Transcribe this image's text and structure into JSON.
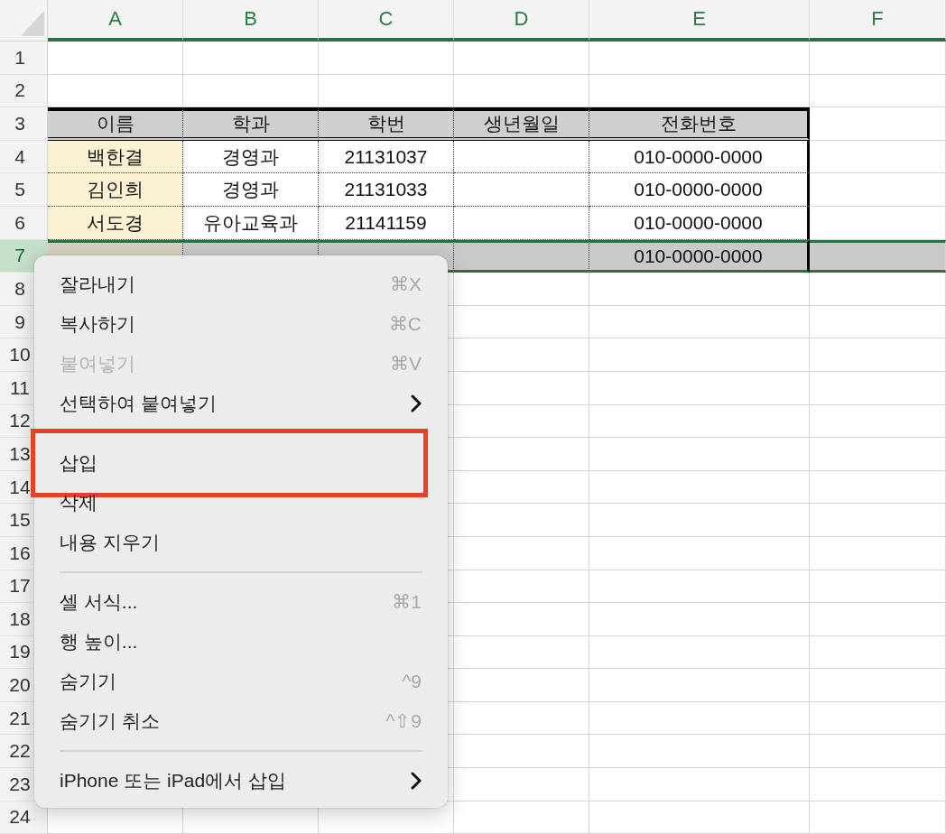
{
  "columns": [
    "A",
    "B",
    "C",
    "D",
    "E",
    "F"
  ],
  "rows": [
    {
      "number": "1",
      "selected": false,
      "kind": "empty"
    },
    {
      "number": "2",
      "selected": false,
      "kind": "empty"
    },
    {
      "number": "3",
      "selected": false,
      "kind": "header",
      "cells": {
        "A": "이름",
        "B": "학과",
        "C": "학번",
        "D": "생년월일",
        "E": "전화번호"
      }
    },
    {
      "number": "4",
      "selected": false,
      "kind": "data",
      "cells": {
        "A": "백한결",
        "B": "경영과",
        "C": "21131037",
        "E": "010-0000-0000"
      }
    },
    {
      "number": "5",
      "selected": false,
      "kind": "data",
      "cells": {
        "A": "김인희",
        "B": "경영과",
        "C": "21131033",
        "E": "010-0000-0000"
      }
    },
    {
      "number": "6",
      "selected": false,
      "kind": "data",
      "cells": {
        "A": "서도경",
        "B": "유아교육과",
        "C": "21141159",
        "E": "010-0000-0000"
      }
    },
    {
      "number": "7",
      "selected": true,
      "kind": "data",
      "cells": {
        "E": "010-0000-0000"
      }
    },
    {
      "number": "8",
      "selected": false,
      "kind": "empty"
    },
    {
      "number": "9",
      "selected": false,
      "kind": "empty"
    },
    {
      "number": "10",
      "selected": false,
      "kind": "empty"
    },
    {
      "number": "11",
      "selected": false,
      "kind": "empty"
    },
    {
      "number": "12",
      "selected": false,
      "kind": "empty"
    },
    {
      "number": "13",
      "selected": false,
      "kind": "empty"
    },
    {
      "number": "14",
      "selected": false,
      "kind": "empty"
    },
    {
      "number": "15",
      "selected": false,
      "kind": "empty"
    },
    {
      "number": "16",
      "selected": false,
      "kind": "empty"
    },
    {
      "number": "17",
      "selected": false,
      "kind": "empty"
    },
    {
      "number": "18",
      "selected": false,
      "kind": "empty"
    },
    {
      "number": "19",
      "selected": false,
      "kind": "empty"
    },
    {
      "number": "20",
      "selected": false,
      "kind": "empty"
    },
    {
      "number": "21",
      "selected": false,
      "kind": "empty"
    },
    {
      "number": "22",
      "selected": false,
      "kind": "empty"
    },
    {
      "number": "23",
      "selected": false,
      "kind": "empty"
    },
    {
      "number": "24",
      "selected": false,
      "kind": "empty"
    }
  ],
  "context_menu": {
    "items": [
      {
        "kind": "item",
        "label": "잘라내기",
        "shortcut": "⌘X",
        "disabled": false,
        "submenu": false,
        "marked": false
      },
      {
        "kind": "item",
        "label": "복사하기",
        "shortcut": "⌘C",
        "disabled": false,
        "submenu": false,
        "marked": false
      },
      {
        "kind": "item",
        "label": "붙여넣기",
        "shortcut": "⌘V",
        "disabled": true,
        "submenu": false,
        "marked": false
      },
      {
        "kind": "item",
        "label": "선택하여 붙여넣기",
        "disabled": false,
        "submenu": true,
        "marked": false
      },
      {
        "kind": "item",
        "label": "삽입",
        "disabled": false,
        "submenu": false,
        "marked": true
      },
      {
        "kind": "item",
        "label": "삭제",
        "disabled": false,
        "submenu": false,
        "marked": false
      },
      {
        "kind": "item",
        "label": "내용 지우기",
        "disabled": false,
        "submenu": false,
        "marked": false
      },
      {
        "kind": "separator"
      },
      {
        "kind": "item",
        "label": "셀 서식...",
        "shortcut": "⌘1",
        "disabled": false,
        "submenu": false,
        "marked": false
      },
      {
        "kind": "item",
        "label": "행 높이...",
        "disabled": false,
        "submenu": false,
        "marked": false
      },
      {
        "kind": "item",
        "label": "숨기기",
        "shortcut": "^9",
        "disabled": false,
        "submenu": false,
        "marked": false
      },
      {
        "kind": "item",
        "label": "숨기기 취소",
        "shortcut": "^⇧9",
        "disabled": false,
        "submenu": false,
        "marked": false
      },
      {
        "kind": "separator"
      },
      {
        "kind": "item",
        "label": "iPhone 또는 iPad에서 삽입",
        "disabled": false,
        "submenu": true,
        "marked": false
      }
    ]
  }
}
